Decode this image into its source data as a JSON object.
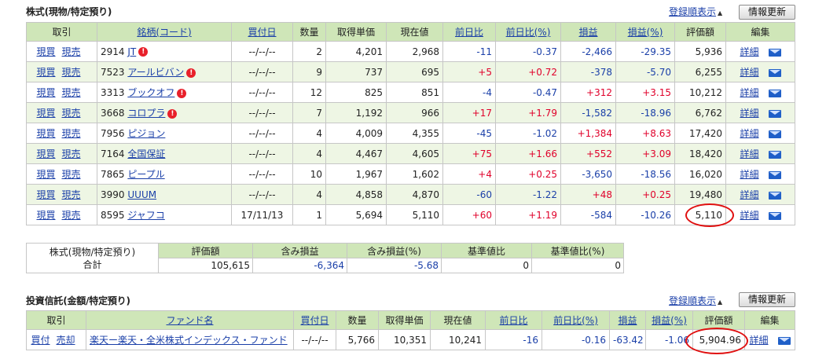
{
  "stocks": {
    "title": "株式(現物/特定預り)",
    "sort_label": "登録順表示",
    "refresh_label": "情報更新",
    "headers": [
      "取引",
      "銘柄(コード)",
      "買付日",
      "数量",
      "取得単価",
      "現在値",
      "前日比",
      "前日比(%)",
      "損益",
      "損益(%)",
      "評価額",
      "編集"
    ],
    "buy_label": "現買",
    "sell_label": "現売",
    "detail_label": "詳細",
    "rows": [
      {
        "code": "2914",
        "name": "JT",
        "alert": true,
        "date": "--/--/--",
        "qty": "2",
        "cost": "4,201",
        "price": "2,968",
        "chg": "-11",
        "chg_pct": "-0.37",
        "pl": "-2,466",
        "pl_pct": "-29.35",
        "value": "5,936"
      },
      {
        "code": "7523",
        "name": "アールビバン",
        "alert": true,
        "date": "--/--/--",
        "qty": "9",
        "cost": "737",
        "price": "695",
        "chg": "+5",
        "chg_pct": "+0.72",
        "pl": "-378",
        "pl_pct": "-5.70",
        "value": "6,255"
      },
      {
        "code": "3313",
        "name": "ブックオフ",
        "alert": true,
        "date": "--/--/--",
        "qty": "12",
        "cost": "825",
        "price": "851",
        "chg": "-4",
        "chg_pct": "-0.47",
        "pl": "+312",
        "pl_pct": "+3.15",
        "value": "10,212"
      },
      {
        "code": "3668",
        "name": "コロプラ",
        "alert": true,
        "date": "--/--/--",
        "qty": "7",
        "cost": "1,192",
        "price": "966",
        "chg": "+17",
        "chg_pct": "+1.79",
        "pl": "-1,582",
        "pl_pct": "-18.96",
        "value": "6,762"
      },
      {
        "code": "7956",
        "name": "ピジョン",
        "alert": false,
        "date": "--/--/--",
        "qty": "4",
        "cost": "4,009",
        "price": "4,355",
        "chg": "-45",
        "chg_pct": "-1.02",
        "pl": "+1,384",
        "pl_pct": "+8.63",
        "value": "17,420"
      },
      {
        "code": "7164",
        "name": "全国保証",
        "alert": false,
        "date": "--/--/--",
        "qty": "4",
        "cost": "4,467",
        "price": "4,605",
        "chg": "+75",
        "chg_pct": "+1.66",
        "pl": "+552",
        "pl_pct": "+3.09",
        "value": "18,420"
      },
      {
        "code": "7865",
        "name": "ピープル",
        "alert": false,
        "date": "--/--/--",
        "qty": "10",
        "cost": "1,967",
        "price": "1,602",
        "chg": "+4",
        "chg_pct": "+0.25",
        "pl": "-3,650",
        "pl_pct": "-18.56",
        "value": "16,020"
      },
      {
        "code": "3990",
        "name": "UUUM",
        "alert": false,
        "date": "--/--/--",
        "qty": "4",
        "cost": "4,858",
        "price": "4,870",
        "chg": "-60",
        "chg_pct": "-1.22",
        "pl": "+48",
        "pl_pct": "+0.25",
        "value": "19,480"
      },
      {
        "code": "8595",
        "name": "ジャフコ",
        "alert": false,
        "date": "17/11/13",
        "qty": "1",
        "cost": "5,694",
        "price": "5,110",
        "chg": "+60",
        "chg_pct": "+1.19",
        "pl": "-584",
        "pl_pct": "-10.26",
        "value": "5,110"
      }
    ]
  },
  "summary": {
    "label_line1": "株式(現物/特定預り)",
    "label_line2": "合計",
    "headers": [
      "評価額",
      "含み損益",
      "含み損益(%)",
      "基準値比",
      "基準値比(%)"
    ],
    "values": [
      "105,615",
      "-6,364",
      "-5.68",
      "0",
      "0"
    ]
  },
  "funds": {
    "title": "投資信託(金額/特定預り)",
    "sort_label": "登録順表示",
    "refresh_label": "情報更新",
    "headers": [
      "取引",
      "ファンド名",
      "買付日",
      "数量",
      "取得単価",
      "現在値",
      "前日比",
      "前日比(%)",
      "損益",
      "損益(%)",
      "評価額",
      "編集"
    ],
    "buy_label": "買付",
    "sell_label": "売却",
    "detail_label": "詳細",
    "rows": [
      {
        "name": "楽天ー楽天・全米株式インデックス・ファンド",
        "date": "--/--/--",
        "qty": "5,766",
        "cost": "10,351",
        "price": "10,241",
        "chg": "-16",
        "chg_pct": "-0.16",
        "pl": "-63.42",
        "pl_pct": "-1.06",
        "value": "5,904.96"
      }
    ]
  },
  "colors": {
    "header_bg": "#cfe6b8",
    "row_alt": "#eef6e4",
    "positive": "#e0002a",
    "negative": "#1a3fa8",
    "highlight_circle": "#e01010"
  }
}
